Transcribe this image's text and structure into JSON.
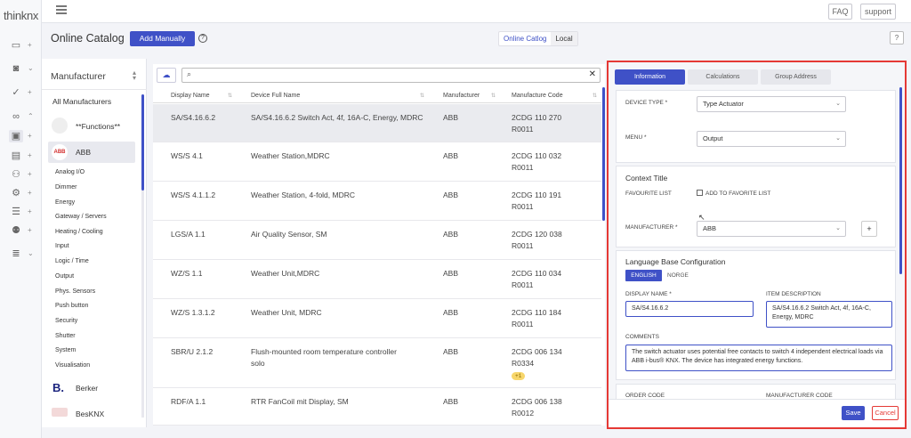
{
  "app": {
    "logo": "thinknx"
  },
  "topbar": {
    "faq": "FAQ",
    "support": "support"
  },
  "header": {
    "title": "Online Catalog",
    "add_manually": "Add Manually",
    "help": "?",
    "toggle": {
      "online": "Online Catlog",
      "local": "Local"
    },
    "right_help": "?"
  },
  "manufacturer": {
    "heading": "Manufacturer",
    "items": [
      "All Manufacturers",
      "**Functions**",
      "ABB"
    ],
    "abb_categories": [
      "Analog I/O",
      "Dimmer",
      "Energy",
      "Gateway / Servers",
      "Heating / Cooling",
      "Input",
      "Logic / Time",
      "Output",
      "Phys. Sensors",
      "Push button",
      "Security",
      "Shutter",
      "System",
      "Visualisation"
    ],
    "more": [
      "Berker",
      "BesKNX"
    ],
    "abb_logo": "ABB",
    "berker_logo": "B."
  },
  "table": {
    "columns": [
      "Display Name",
      "Device Full Name",
      "Manufacturer",
      "Manufacture Code"
    ],
    "rows": [
      {
        "name": "SA/S4.16.6.2",
        "full": "SA/S4.16.6.2 Switch Act, 4f, 16A-C, Energy, MDRC",
        "mfg": "ABB",
        "code": "2CDG 110 270 R0011"
      },
      {
        "name": "WS/S 4.1",
        "full": "Weather Station,MDRC",
        "mfg": "ABB",
        "code": "2CDG 110 032 R0011"
      },
      {
        "name": "WS/S 4.1.1.2",
        "full": "Weather Station, 4-fold, MDRC",
        "mfg": "ABB",
        "code": "2CDG 110 191 R0011"
      },
      {
        "name": "LGS/A 1.1",
        "full": "Air Quality Sensor, SM",
        "mfg": "ABB",
        "code": "2CDG 120 038 R0011"
      },
      {
        "name": "WZ/S 1.1",
        "full": "Weather Unit,MDRC",
        "mfg": "ABB",
        "code": "2CDG 110 034 R0011"
      },
      {
        "name": "WZ/S 1.3.1.2",
        "full": "Weather Unit, MDRC",
        "mfg": "ABB",
        "code": "2CDG 110 184 R0011"
      },
      {
        "name": "SBR/U 2.1.2",
        "full": "Flush-mounted room temperature controller solo",
        "mfg": "ABB",
        "code": "2CDG 006 134 R0334",
        "badge": "+1"
      },
      {
        "name": "RDF/A 1.1",
        "full": "RTR FanCoil mit Display, SM",
        "mfg": "ABB",
        "code": "2CDG 006 138 R0012"
      }
    ]
  },
  "detail": {
    "tabs": [
      "Information",
      "Calculations",
      "Group Address"
    ],
    "device_type_label": "DEVICE TYPE *",
    "device_type_value": "Type Actuator",
    "menu_label": "MENU *",
    "menu_value": "Output",
    "context_title": "Context Title",
    "favourite_label": "FAVOURITE LIST",
    "favourite_checkbox": "ADD TO FAVORITE LIST",
    "manufacturer_label": "MANUFACTURER *",
    "manufacturer_value": "ABB",
    "add_symbol": "+",
    "lang_title": "Language Base Configuration",
    "lang_tabs": [
      "ENGLISH",
      "NORGE"
    ],
    "display_name_label": "DISPLAY NAME *",
    "display_name_value": "SA/S4.16.6.2",
    "item_desc_label": "ITEM DESCRIPTION",
    "item_desc_value": "SA/S4.16.6.2 Switch Act, 4f, 16A-C, Energy, MDRC",
    "comments_label": "COMMENTS",
    "comments_value": "The switch actuator uses potential free contacts to switch 4 independent electrical loads via ABB i-bus® KNX. The device has integrated energy functions.",
    "order_code_label": "ORDER CODE",
    "mfg_code_label": "MANUFACTURER CODE",
    "save": "Save",
    "cancel": "Cancel"
  }
}
